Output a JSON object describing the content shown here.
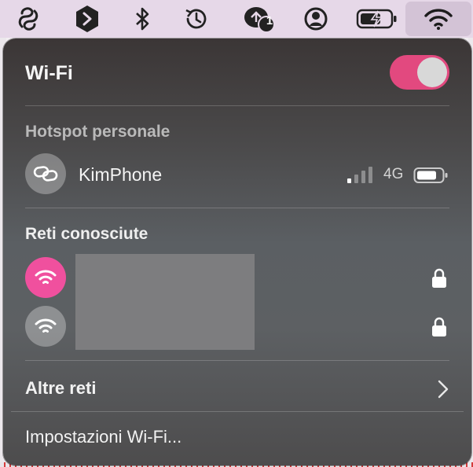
{
  "menubar": {
    "icons": [
      "app-s-icon",
      "cube-shield-icon",
      "bluetooth-icon",
      "time-machine-icon",
      "notification-badge-icon",
      "user-account-icon",
      "battery-charging-icon",
      "wifi-icon"
    ],
    "notification_count": "1"
  },
  "wifi": {
    "title": "Wi-Fi",
    "enabled": true
  },
  "hotspot": {
    "header": "Hotspot personale",
    "device": "KimPhone",
    "network_type": "4G",
    "signal_bars": 1
  },
  "known": {
    "header": "Reti conosciute"
  },
  "other": {
    "label": "Altre reti"
  },
  "settings": {
    "label": "Impostazioni Wi-Fi..."
  },
  "colors": {
    "accent": "#e2497f",
    "connected": "#f0509e"
  }
}
